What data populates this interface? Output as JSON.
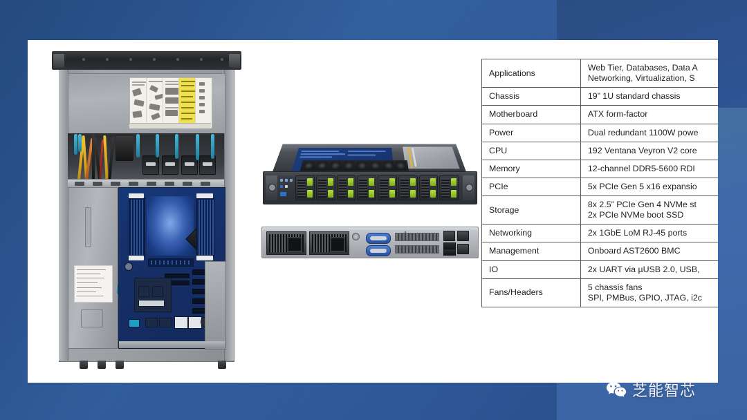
{
  "slide": {
    "kind": "product-spec-slide",
    "photos": [
      {
        "name": "server-open-top-view",
        "caption": ""
      },
      {
        "name": "server-front-three-quarter-view",
        "caption": ""
      },
      {
        "name": "server-rear-io-view",
        "caption": ""
      }
    ]
  },
  "spec_table": {
    "rows": [
      {
        "key": "Applications",
        "value": "Web Tier, Databases, Data A",
        "value_line2": "Networking, Virtualization, S"
      },
      {
        "key": "Chassis",
        "value": "19” 1U standard chassis",
        "value_line2": ""
      },
      {
        "key": "Motherboard",
        "value": "ATX form-factor",
        "value_line2": ""
      },
      {
        "key": "Power",
        "value": "Dual redundant 1100W powe",
        "value_line2": ""
      },
      {
        "key": "CPU",
        "value": "192 Ventana Veyron V2 core",
        "value_line2": ""
      },
      {
        "key": "Memory",
        "value": "12-channel DDR5-5600 RDI",
        "value_line2": ""
      },
      {
        "key": "PCIe",
        "value": "5x PCIe Gen 5 x16 expansio",
        "value_line2": ""
      },
      {
        "key": "Storage",
        "value": "8x 2.5” PCIe Gen 4 NVMe st",
        "value_line2": "2x PCIe NVMe boot SSD"
      },
      {
        "key": "Networking",
        "value": "2x 1GbE LoM RJ-45 ports",
        "value_line2": ""
      },
      {
        "key": "Management",
        "value": "Onboard AST2600 BMC",
        "value_line2": ""
      },
      {
        "key": "IO",
        "value": "2x UART via µUSB 2.0, USB,",
        "value_line2": ""
      },
      {
        "key": "Fans/Headers",
        "value": "5 chassis fans",
        "value_line2": "SPI, PMBus, GPIO, JTAG, i2c"
      }
    ]
  },
  "watermark": {
    "icon": "wechat-icon",
    "text": "芝能智芯"
  },
  "colors": {
    "background_left": "#305f9e",
    "background_right_top": "#2c4d84",
    "background_right_bottom": "#416ca6",
    "slide_background": "#ffffff",
    "table_border": "#5a5a5a",
    "table_text": "#231f20",
    "watermark_text": "#eef2f8"
  }
}
